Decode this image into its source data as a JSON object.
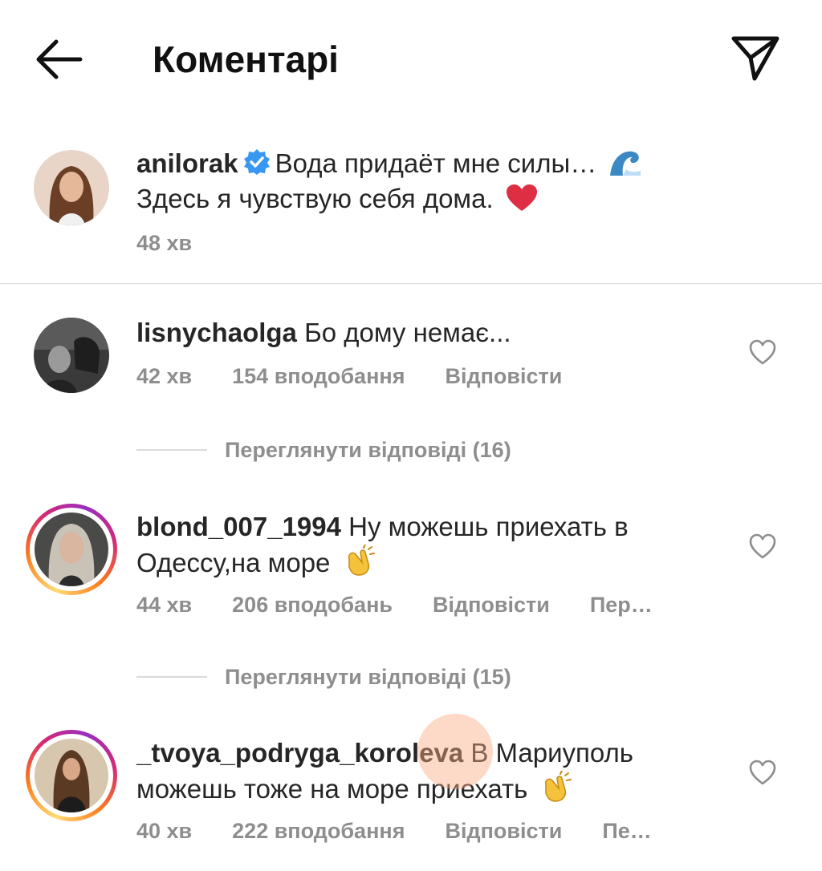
{
  "header": {
    "title": "Коментарі"
  },
  "caption": {
    "username": "anilorak",
    "text_line1": "Вода придаёт мне силы… ",
    "text_line2": "Здесь я чувствую себя дома. ",
    "time": "48 хв"
  },
  "comments": [
    {
      "username": "lisnychaolga",
      "text": "Бо дому немає...",
      "time": "42 хв",
      "likes": "154 вподобання",
      "reply": "Відповісти",
      "view_replies": "Переглянути відповіді (16)"
    },
    {
      "username": "blond_007_1994",
      "text_line1": "Ну можешь приехать в",
      "text_line2": "Одессу,на море ",
      "time": "44 хв",
      "likes": "206 вподобань",
      "reply": "Відповісти",
      "translate": "Пер…",
      "view_replies": "Переглянути відповіді (15)"
    },
    {
      "username": "_tvoya_podryga_koroleva",
      "text_line1": "В Мариуполь",
      "text_line2": "можешь тоже на море приехать ",
      "time": "40 хв",
      "likes": "222 вподобання",
      "reply": "Відповісти",
      "translate": "Пе…"
    }
  ],
  "colors": {
    "text": "#262626",
    "secondary": "#8e8e8e",
    "divider": "#dbdbdb",
    "verified": "#3897f0",
    "heart_emoji": "#e0245e"
  },
  "icons": {
    "back": "arrow-left-icon",
    "send": "paper-plane-icon",
    "like": "heart-outline-icon",
    "verified": "verified-badge-icon"
  }
}
